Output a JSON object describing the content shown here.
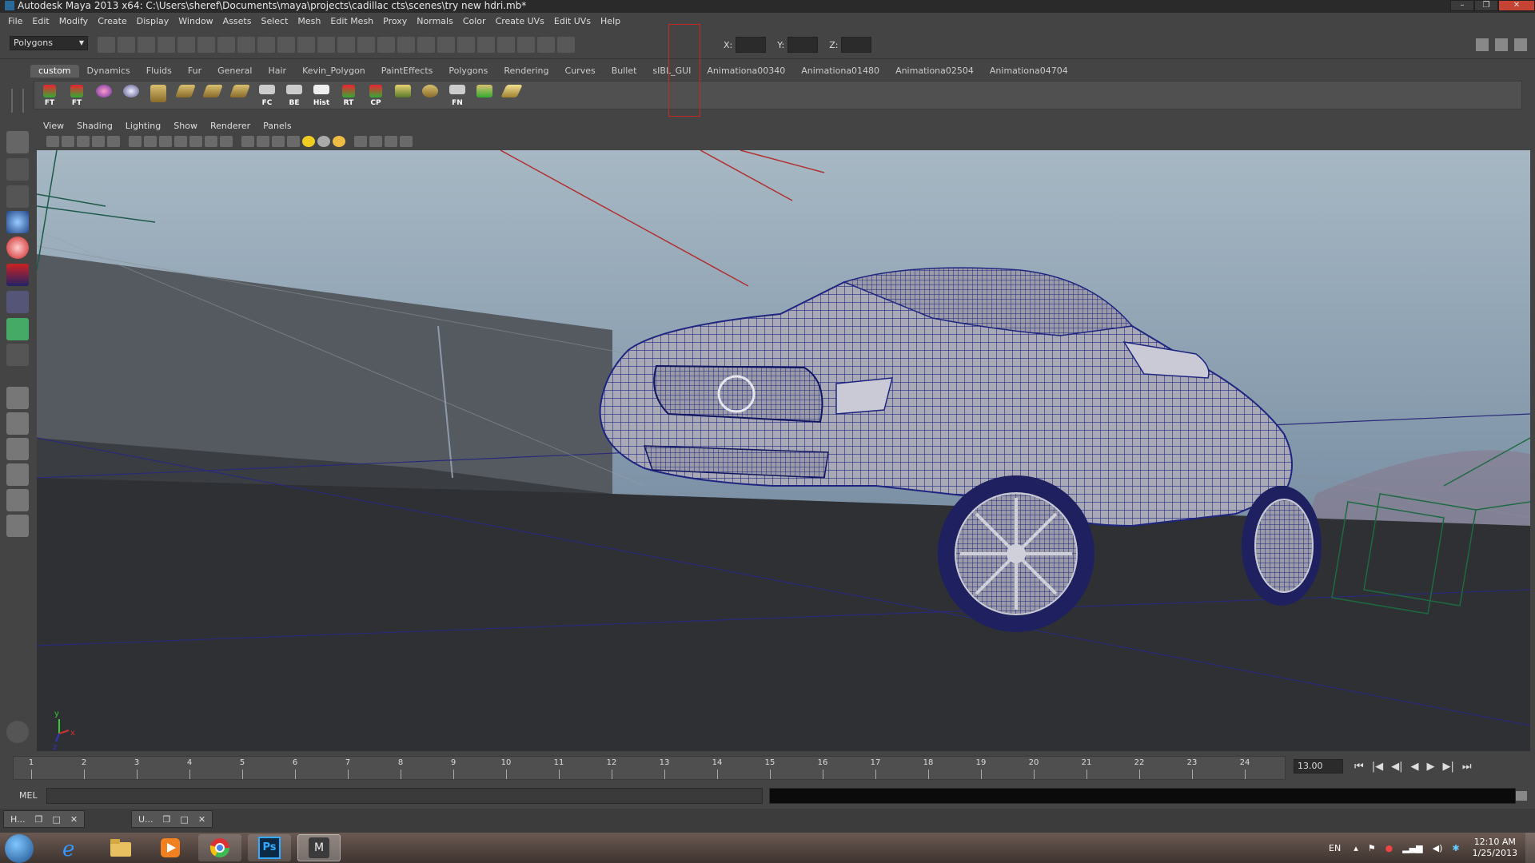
{
  "window": {
    "title": "Autodesk Maya 2013 x64: C:\\Users\\sheref\\Documents\\maya\\projects\\cadillac cts\\scenes\\try new hdri.mb*",
    "min": "–",
    "max": "❐",
    "close": "✕"
  },
  "menu": [
    "File",
    "Edit",
    "Modify",
    "Create",
    "Display",
    "Window",
    "Assets",
    "Select",
    "Mesh",
    "Edit Mesh",
    "Proxy",
    "Normals",
    "Color",
    "Create UVs",
    "Edit UVs",
    "Help"
  ],
  "status_line": {
    "mode": "Polygons",
    "x_label": "X:",
    "y_label": "Y:",
    "z_label": "Z:"
  },
  "shelf": {
    "tabs": [
      "custom",
      "Dynamics",
      "Fluids",
      "Fur",
      "General",
      "Hair",
      "Kevin_Polygon",
      "PaintEffects",
      "Polygons",
      "Rendering",
      "Curves",
      "Bullet",
      "sIBL_GUI",
      "Animationa00340",
      "Animationa01480",
      "Animationa02504",
      "Animationa04704"
    ],
    "active_tab": 0,
    "icon_labels": [
      "FT",
      "FT",
      "",
      "",
      "",
      "",
      "",
      "",
      "",
      "FC",
      "BE",
      "Hist",
      "RT",
      "CP",
      "",
      "",
      "FN",
      "",
      ""
    ]
  },
  "panel": {
    "menu": [
      "View",
      "Shading",
      "Lighting",
      "Show",
      "Renderer",
      "Panels"
    ]
  },
  "viewport": {
    "label": "",
    "axis_y": "y",
    "axis_x": "x",
    "axis_z": "z"
  },
  "time_slider": {
    "ticks": [
      "1",
      "2",
      "3",
      "4",
      "5",
      "6",
      "7",
      "8",
      "9",
      "10",
      "11",
      "12",
      "13",
      "14",
      "15",
      "16",
      "17",
      "18",
      "19",
      "20",
      "21",
      "22",
      "23",
      "24"
    ],
    "current_frame": "13.00",
    "buttons": [
      "⏮",
      "|◀",
      "◀|",
      "◀",
      "▶",
      "▶|",
      "⏭"
    ]
  },
  "command_line": {
    "label": "MEL"
  },
  "minimized": [
    {
      "label": "H..."
    },
    {
      "label": "U..."
    }
  ],
  "taskbar": {
    "apps": [
      "IE",
      "Explorer",
      "Media Player",
      "Chrome",
      "Ps",
      "Maya"
    ],
    "lang": "EN",
    "time": "12:10 AM",
    "date": "1/25/2013"
  }
}
